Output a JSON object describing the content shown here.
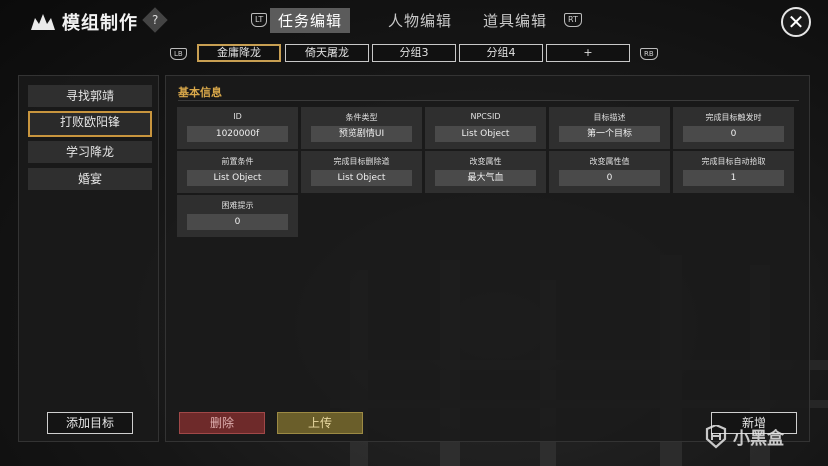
{
  "header": {
    "title": "模组制作",
    "help": "?",
    "lt": "LT",
    "rt": "RT",
    "tabs": [
      {
        "label": "任务编辑",
        "active": true
      },
      {
        "label": "人物编辑",
        "active": false
      },
      {
        "label": "道具编辑",
        "active": false
      }
    ],
    "close": "✕"
  },
  "groups": {
    "lb": "LB",
    "rb": "RB",
    "items": [
      {
        "label": "金庸降龙",
        "active": true
      },
      {
        "label": "倚天屠龙",
        "active": false
      },
      {
        "label": "分组3",
        "active": false
      },
      {
        "label": "分组4",
        "active": false
      },
      {
        "label": "+",
        "active": false
      }
    ]
  },
  "sidebar": {
    "items": [
      {
        "label": "寻找郭靖",
        "active": false
      },
      {
        "label": "打败欧阳锋",
        "active": true
      },
      {
        "label": "学习降龙",
        "active": false
      },
      {
        "label": "婚宴",
        "active": false
      }
    ],
    "add_button": "添加目标"
  },
  "main": {
    "section_title": "基本信息",
    "fields": [
      {
        "label": "ID",
        "value": "1020000f"
      },
      {
        "label": "条件类型",
        "value": "预览剧情UI"
      },
      {
        "label": "NPCSID",
        "value": "List Object"
      },
      {
        "label": "目标描述",
        "value": "第一个目标"
      },
      {
        "label": "完成目标触发时",
        "value": "0"
      },
      {
        "label": "前置条件",
        "value": "List Object"
      },
      {
        "label": "完成目标删除道",
        "value": "List Object"
      },
      {
        "label": "改变属性",
        "value": "最大气血"
      },
      {
        "label": "改变属性值",
        "value": "0"
      },
      {
        "label": "完成目标自动拾取",
        "value": "1"
      },
      {
        "label": "困难提示",
        "value": "0"
      }
    ],
    "delete_button": "删除",
    "upload_button": "上传",
    "new_button": "新增"
  },
  "watermark": "小黑盒",
  "colors": {
    "accent": "#c8953e",
    "section_title": "#d9a84a",
    "delete": "#6e2a2a",
    "upload": "#6a5e2a"
  }
}
